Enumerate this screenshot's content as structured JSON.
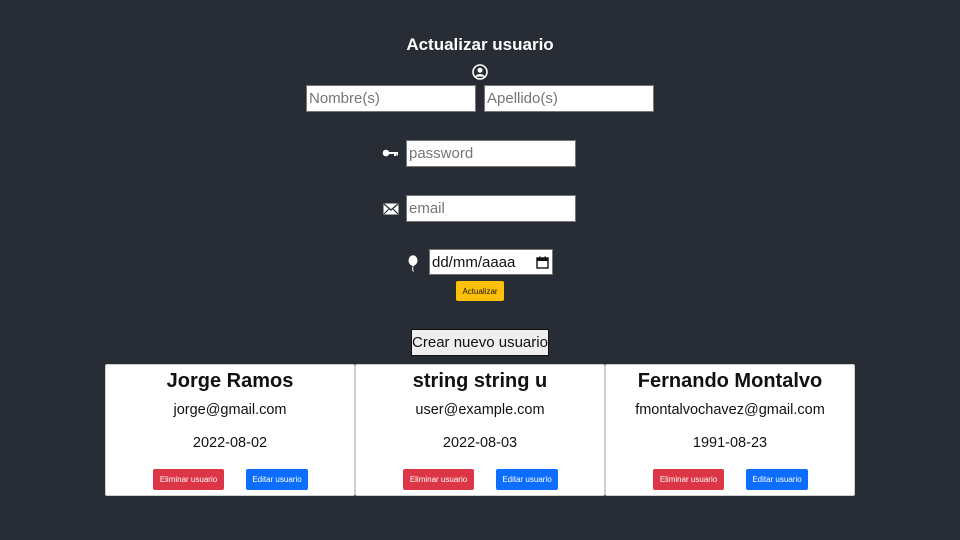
{
  "form": {
    "title": "Actualizar usuario",
    "first_name_placeholder": "Nombre(s)",
    "last_name_placeholder": "Apellido(s)",
    "password_placeholder": "password",
    "email_placeholder": "email",
    "date_placeholder": "dd/mm/aaaa",
    "update_button": "Actualizar",
    "icons": [
      "user-circle-icon",
      "key-icon",
      "envelope-icon",
      "balloon-icon",
      "calendar-icon"
    ]
  },
  "create_button": "Crear nuevo usuario",
  "users": [
    {
      "name": "Jorge Ramos",
      "email": "jorge@gmail.com",
      "date": "2022-08-02",
      "delete_label": "Eliminar usuario",
      "edit_label": "Editar usuario"
    },
    {
      "name": "string string u",
      "email": "user@example.com",
      "date": "2022-08-03",
      "delete_label": "Eliminar usuario",
      "edit_label": "Editar usuario"
    },
    {
      "name": "Fernando Montalvo",
      "email": "fmontalvochavez@gmail.com",
      "date": "1991-08-23",
      "delete_label": "Eliminar usuario",
      "edit_label": "Editar usuario"
    }
  ],
  "colors": {
    "background": "#282c34",
    "update_button": "#ffc107",
    "delete_button": "#dc3545",
    "edit_button": "#0d6efd"
  }
}
